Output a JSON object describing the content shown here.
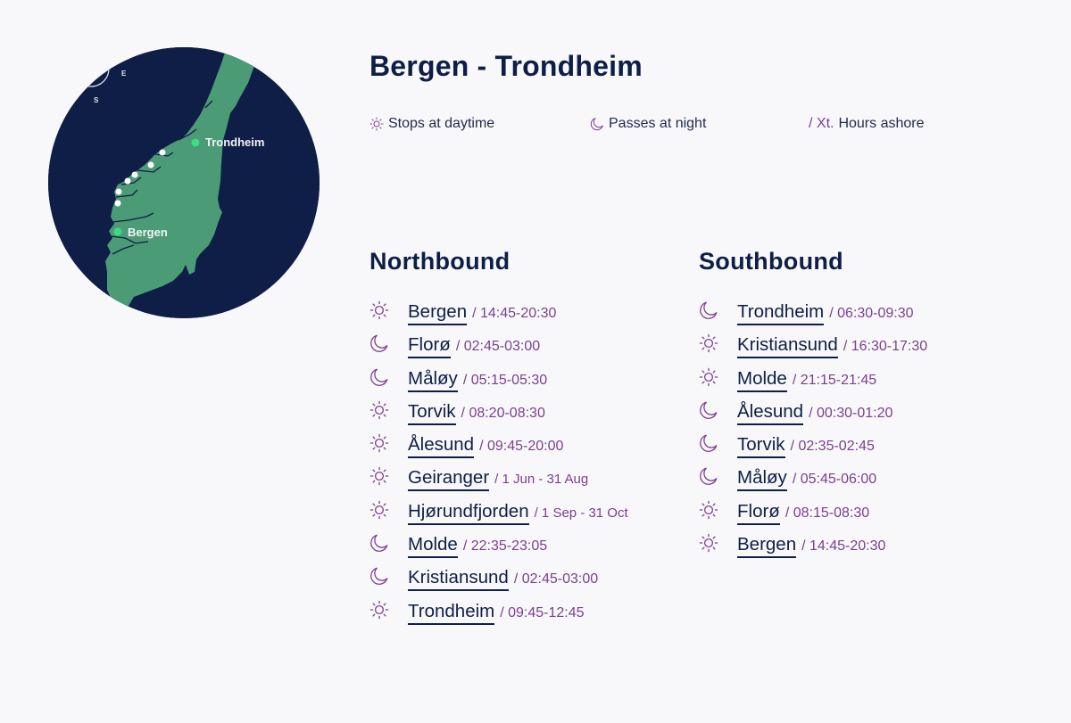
{
  "route": {
    "title": "Bergen - Trondheim"
  },
  "map": {
    "labels": {
      "origin": "Bergen",
      "destination": "Trondheim"
    },
    "compass": {
      "east": "E",
      "south": "S"
    },
    "colors": {
      "sea": "#0e1e46",
      "land": "#4b9b76",
      "port_marker": "#3ddc84",
      "stop_marker": "#ffffff"
    }
  },
  "legend": {
    "daytime": {
      "icon": "sun-icon",
      "label": "Stops at daytime"
    },
    "night": {
      "icon": "moon-icon",
      "label": "Passes at night"
    },
    "ashore": {
      "prefix": "/ Xt.",
      "label": "Hours ashore"
    }
  },
  "northbound": {
    "heading": "Northbound",
    "stops": [
      {
        "icon": "sun-icon",
        "name": "Bergen",
        "time": "/ 14:45-20:30"
      },
      {
        "icon": "moon-icon",
        "name": "Florø",
        "time": "/ 02:45-03:00"
      },
      {
        "icon": "moon-icon",
        "name": "Måløy",
        "time": "/ 05:15-05:30"
      },
      {
        "icon": "sun-icon",
        "name": "Torvik",
        "time": "/ 08:20-08:30"
      },
      {
        "icon": "sun-icon",
        "name": "Ålesund",
        "time": "/ 09:45-20:00"
      },
      {
        "icon": "sun-icon",
        "name": "Geiranger",
        "time": "/ 1 Jun - 31 Aug"
      },
      {
        "icon": "sun-icon",
        "name": "Hjørundfjorden",
        "time": "/ 1 Sep - 31 Oct"
      },
      {
        "icon": "moon-icon",
        "name": "Molde",
        "time": "/ 22:35-23:05"
      },
      {
        "icon": "moon-icon",
        "name": "Kristiansund",
        "time": "/ 02:45-03:00"
      },
      {
        "icon": "sun-icon",
        "name": "Trondheim",
        "time": "/ 09:45-12:45"
      }
    ]
  },
  "southbound": {
    "heading": "Southbound",
    "stops": [
      {
        "icon": "moon-icon",
        "name": "Trondheim",
        "time": "/ 06:30-09:30"
      },
      {
        "icon": "sun-icon",
        "name": "Kristiansund",
        "time": "/ 16:30-17:30"
      },
      {
        "icon": "sun-icon",
        "name": "Molde",
        "time": "/ 21:15-21:45"
      },
      {
        "icon": "moon-icon",
        "name": "Ålesund",
        "time": "/ 00:30-01:20"
      },
      {
        "icon": "moon-icon",
        "name": "Torvik",
        "time": "/ 02:35-02:45"
      },
      {
        "icon": "moon-icon",
        "name": "Måløy",
        "time": "/ 05:45-06:00"
      },
      {
        "icon": "sun-icon",
        "name": "Florø",
        "time": "/ 08:15-08:30"
      },
      {
        "icon": "sun-icon",
        "name": "Bergen",
        "time": "/ 14:45-20:30"
      }
    ]
  },
  "colors": {
    "navy": "#0e1e46",
    "accent_purple": "#7a3f8f",
    "background": "#f8f8fa"
  }
}
